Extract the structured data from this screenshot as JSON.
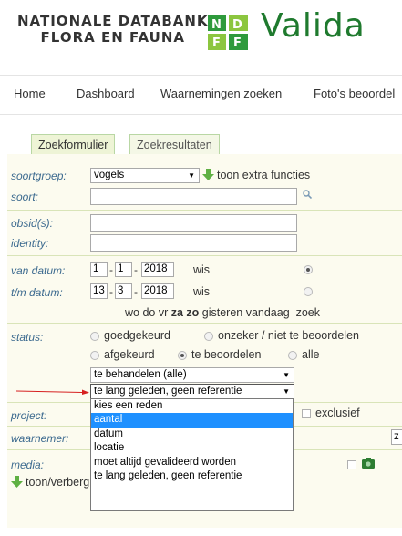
{
  "header": {
    "logo_line1": "NATIONALE DATABANK",
    "logo_line2": "FLORA EN FAUNA",
    "site_title": "Valida",
    "brand_green": "#1f7a2e"
  },
  "nav": {
    "items": [
      "Home",
      "Dashboard",
      "Waarnemingen zoeken",
      "Foto's beoordel"
    ]
  },
  "tabs": {
    "search_form": "Zoekformulier",
    "results": "Zoekresultaten"
  },
  "form": {
    "soortgroep_label": "soortgroep:",
    "soortgroep_value": "vogels",
    "extra_functions": "toon extra functies",
    "soort_label": "soort:",
    "obsid_label": "obsid(s):",
    "identity_label": "identity:",
    "van_datum_label": "van datum:",
    "van_day": "1",
    "van_month": "1",
    "van_year": "2018",
    "tm_datum_label": "t/m datum:",
    "tm_day": "13",
    "tm_month": "3",
    "tm_year": "2018",
    "wis": "wis",
    "quick_dates_prefix": "wo do vr ",
    "quick_dates_bold": "za zo",
    "quick_dates_suffix": " gisteren vandaag  zoek",
    "status_label": "status:",
    "status_opts_row1": [
      "goedgekeurd",
      "onzeker / niet te beoordelen"
    ],
    "status_opts_row2": [
      "afgekeurd",
      "te beoordelen",
      "alle"
    ],
    "behandelen_select": "te behandelen (alle)",
    "reden_select": "te lang geleden, geen referentie",
    "project_label": "project:",
    "exclusief": "exclusief",
    "waarnemer_label": "waarnemer:",
    "media_label": "media:",
    "extra_filters": "toon/verberg extra filteropties",
    "cut_char": "z"
  },
  "dropdown": {
    "options": [
      "kies een reden",
      "aantal",
      "datum",
      "locatie",
      "moet altijd gevalideerd worden",
      "te lang geleden, geen referentie"
    ],
    "selected_index": 1
  },
  "colors": {
    "label_blue": "#3c6a8f",
    "form_bg": "#fcfbef",
    "highlight": "#1e90ff",
    "arrow_red": "#d62020"
  }
}
